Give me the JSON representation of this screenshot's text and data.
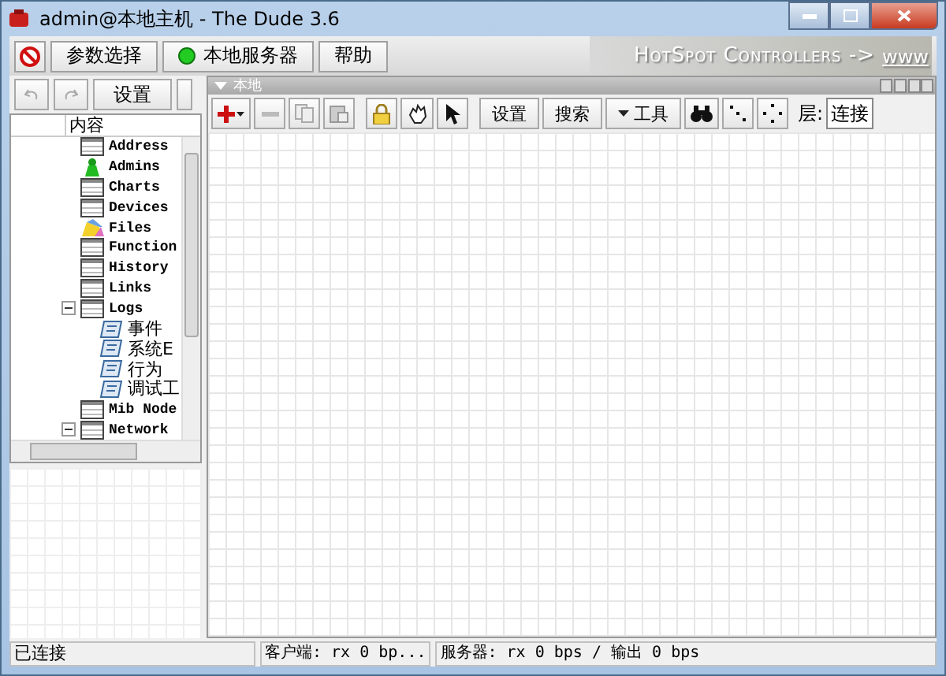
{
  "window": {
    "title": "admin@本地主机 - The Dude 3.6"
  },
  "menu": [
    {
      "kind": "icon"
    },
    {
      "kind": "text",
      "label": "参数选择"
    },
    {
      "kind": "status",
      "label": "本地服务器"
    },
    {
      "kind": "text",
      "label": "帮助"
    }
  ],
  "banner": {
    "text": "HotSpot Controllers -> ",
    "link": "www"
  },
  "left_toolbar": {
    "settings": "设置"
  },
  "tree": {
    "header": "内容",
    "items": [
      {
        "label": "Address",
        "kind": "table"
      },
      {
        "label": "Admins",
        "kind": "admin"
      },
      {
        "label": "Charts",
        "kind": "table"
      },
      {
        "label": "Devices",
        "kind": "table"
      },
      {
        "label": "Files",
        "kind": "files"
      },
      {
        "label": "Function",
        "kind": "table"
      },
      {
        "label": "History",
        "kind": "table"
      },
      {
        "label": "Links",
        "kind": "table"
      },
      {
        "label": "Logs",
        "kind": "table",
        "expanded": true,
        "children": [
          {
            "label": "事件",
            "kind": "log"
          },
          {
            "label": "系统E",
            "kind": "log"
          },
          {
            "label": "行为",
            "kind": "log"
          },
          {
            "label": "调试工",
            "kind": "log"
          }
        ]
      },
      {
        "label": "Mib Node",
        "kind": "table"
      },
      {
        "label": "Network",
        "kind": "table",
        "expanded": true
      }
    ]
  },
  "map_pane": {
    "title": "本地",
    "settings": "设置",
    "search": "搜索",
    "tools": "工具",
    "layer_label": "层:",
    "layer_value": "连接"
  },
  "status_bar": [
    "已连接",
    "客户端: rx 0 bp...",
    "服务器: rx 0 bps / 输出 0 bps"
  ]
}
